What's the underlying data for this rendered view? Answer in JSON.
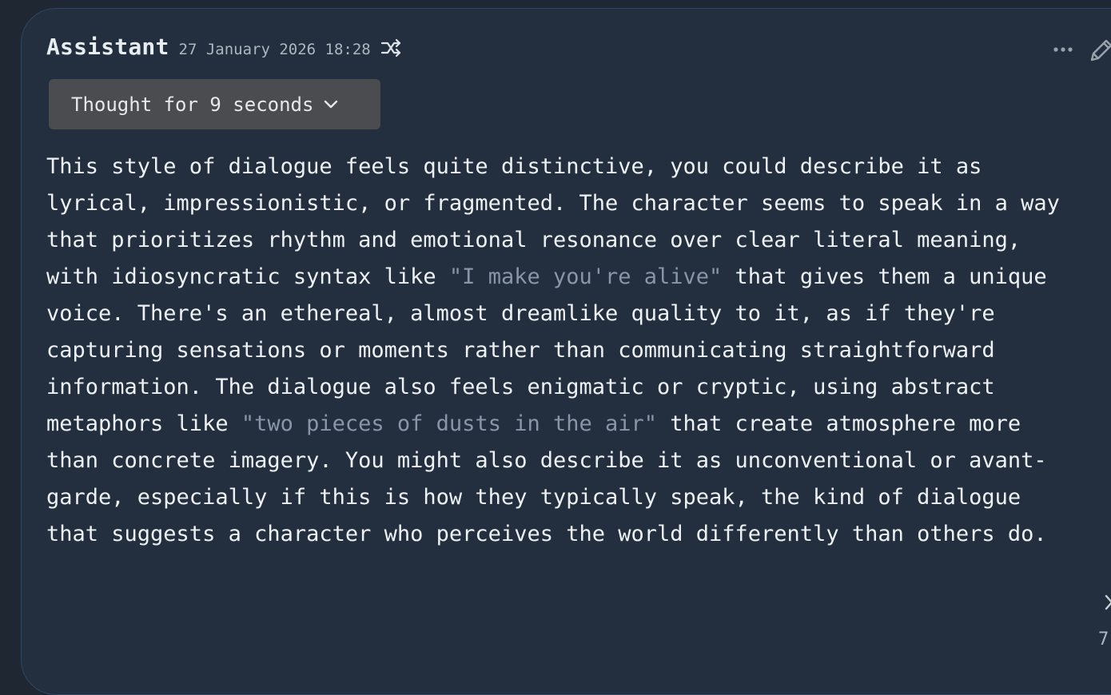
{
  "message": {
    "sender": "Assistant",
    "timestamp": "27 January 2026 18:28",
    "thought_label": "Thought for 9 seconds",
    "paragraph": {
      "part1": "This style of dialogue feels quite distinctive, you could describe it as lyrical, impressionistic, or fragmented. The character seems to speak in a way that prioritizes rhythm and emotional resonance over clear literal meaning, with idiosyncratic syntax like ",
      "quote1": "\"I make you're alive\"",
      "part2": " that gives them a unique voice. There's an ethereal, almost dreamlike quality to it, as if they're capturing sensations or moments rather than communicating straightforward information. The dialogue also feels enigmatic or cryptic, using abstract metaphors like ",
      "quote2": "\"two pieces of dusts in the air\"",
      "part3": " that create atmosphere more than concrete imagery. You might also describe it as unconventional or avant-garde, especially if this is how they typically speak, the kind of dialogue that suggests a character who perceives the world differently than others do."
    }
  },
  "corner": {
    "number": "7"
  },
  "icons": {
    "shuffle": "shuffle-icon",
    "more": "more-options-icon",
    "edit": "pencil-icon",
    "expand": "chevron-down-icon"
  },
  "colors": {
    "background": "#1f2732",
    "card": "#232f3e",
    "card_border": "#2b4766",
    "text": "#eef1f4",
    "quote": "#8797a8",
    "thought_button": "#4a4c4f"
  }
}
